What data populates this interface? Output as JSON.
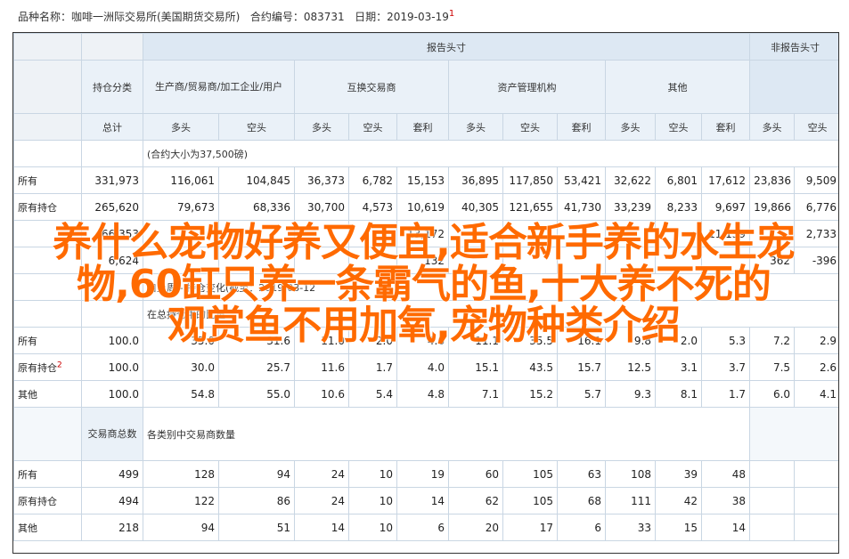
{
  "header_info": {
    "product_label": "品种名称：咖啡一洲际交易所(美国期货交易所)",
    "code_label": "合约编号：083731",
    "date_label": "日期：2019-03-19",
    "footnote": "1"
  },
  "table": {
    "report_group": "报告头寸",
    "nonreport_group": "非报告头寸",
    "position_category": "持仓分类",
    "producer": "生产商/贸易商/加工企业/用户",
    "swap": "互换交易商",
    "asset_mgr": "资产管理机构",
    "other": "其他",
    "total": "总计",
    "long": "多头",
    "short": "空头",
    "spread": "套利",
    "contract_note": "(合约大小为37,500磅)",
    "section1": [
      {
        "label": "所有",
        "values": [
          "331,973",
          "116,061",
          "104,845",
          "36,373",
          "6,782",
          "15,153",
          "36,895",
          "117,850",
          "53,421",
          "32,622",
          "6,801",
          "17,612",
          "23,836",
          "9,509"
        ]
      },
      {
        "label": "原有持仓",
        "values": [
          "265,620",
          "79,673",
          "68,336",
          "30,700",
          "4,573",
          "10,619",
          "40,305",
          "121,655",
          "41,730",
          "33,239",
          "8,233",
          "9,697",
          "19,866",
          "6,776"
        ]
      },
      {
        "label": "",
        "values": [
          "66,353",
          "",
          "",
          "",
          "",
          "13,172",
          "",
          "",
          "",
          "",
          "",
          "11,139",
          "",
          "2,733"
        ]
      },
      {
        "label": "",
        "values": [
          "6,624",
          "",
          "",
          "",
          "",
          "132",
          "",
          "",
          "",
          "",
          "",
          "",
          "362",
          "-396"
        ]
      }
    ],
    "change_note": "自上周 - 持仓变化(截至：2019-03-12",
    "pct_note": "在总持仓中的比重",
    "section2": [
      {
        "label": "所有",
        "values": [
          "100.0",
          "35.0",
          "31.6",
          "11.0",
          "2.0",
          "4.6",
          "11.1",
          "35.5",
          "16.1",
          "9.8",
          "2.0",
          "5.3",
          "7.2",
          "2.9"
        ]
      },
      {
        "label": "原有持仓",
        "sup": "2",
        "values": [
          "100.0",
          "30.0",
          "25.7",
          "11.6",
          "1.7",
          "4.0",
          "15.1",
          "43.5",
          "15.7",
          "12.5",
          "3.1",
          "3.7",
          "7.5",
          "2.6"
        ]
      },
      {
        "label": "其他",
        "values": [
          "100.0",
          "54.8",
          "55.0",
          "10.6",
          "5.4",
          "4.8",
          "7.1",
          "15.2",
          "5.7",
          "9.3",
          "8.1",
          "1.7",
          "6.0",
          "4.1"
        ]
      }
    ],
    "trader_total": "交易商总数",
    "trader_note": "各类别中交易商数量",
    "section3": [
      {
        "label": "所有",
        "values": [
          "499",
          "128",
          "94",
          "24",
          "10",
          "19",
          "60",
          "105",
          "63",
          "108",
          "39",
          "48",
          "",
          ""
        ]
      },
      {
        "label": "原有持仓",
        "values": [
          "494",
          "122",
          "86",
          "24",
          "10",
          "14",
          "62",
          "105",
          "68",
          "111",
          "42",
          "38",
          "",
          ""
        ]
      },
      {
        "label": "其他",
        "values": [
          "218",
          "94",
          "51",
          "14",
          "10",
          "6",
          "20",
          "17",
          "6",
          "33",
          "15",
          "14",
          "",
          ""
        ]
      }
    ]
  },
  "overlay": {
    "line1": "养什么宠物好养又便宜,适合新手养的水生宠",
    "line2": "物,60缸只养一条霸气的鱼,十大养不死的",
    "line3": "观赏鱼不用加氧,宠物种类介绍"
  }
}
